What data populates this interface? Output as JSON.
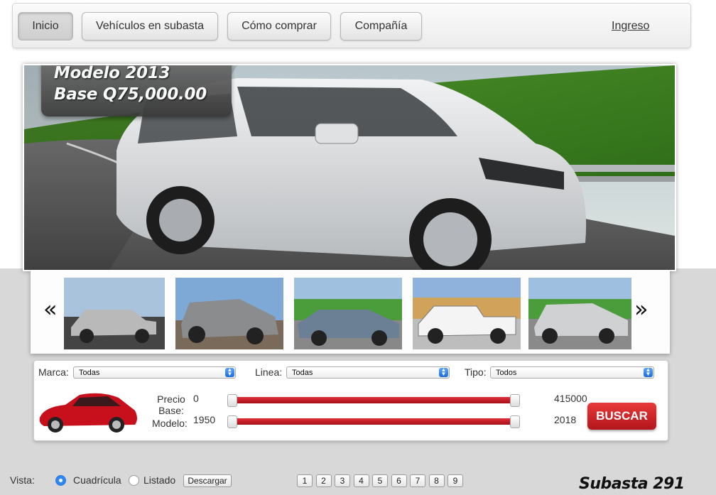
{
  "nav": {
    "items": [
      {
        "label": "Inicio",
        "active": true
      },
      {
        "label": "Vehículos en subasta",
        "active": false
      },
      {
        "label": "Cómo comprar",
        "active": false
      },
      {
        "label": "Compañía",
        "active": false
      }
    ],
    "login": "Ingreso"
  },
  "hero": {
    "line1": "Modelo 2013",
    "line2": "Base Q75,000.00"
  },
  "carousel": {
    "prev_icon": "«",
    "next_icon": "»"
  },
  "filters": {
    "marca": {
      "label": "Marca:",
      "value": "Todas"
    },
    "linea": {
      "label": "Linea:",
      "value": "Todas"
    },
    "tipo": {
      "label": "Tipo:",
      "value": "Todos"
    }
  },
  "ranges": {
    "precio_label": "Precio\nBase:",
    "modelo_label": "Modelo:",
    "precio_min": "0",
    "precio_max": "415000",
    "modelo_min": "1950",
    "modelo_max": "2018"
  },
  "buscar": "BUSCAR",
  "view": {
    "label": "Vista:",
    "grid": "Cuadrícula",
    "list": "Listado",
    "selected": "grid",
    "download": "Descargar"
  },
  "pages": [
    "1",
    "2",
    "3",
    "4",
    "5",
    "6",
    "7",
    "8",
    "9"
  ],
  "brand": "Subasta 291"
}
